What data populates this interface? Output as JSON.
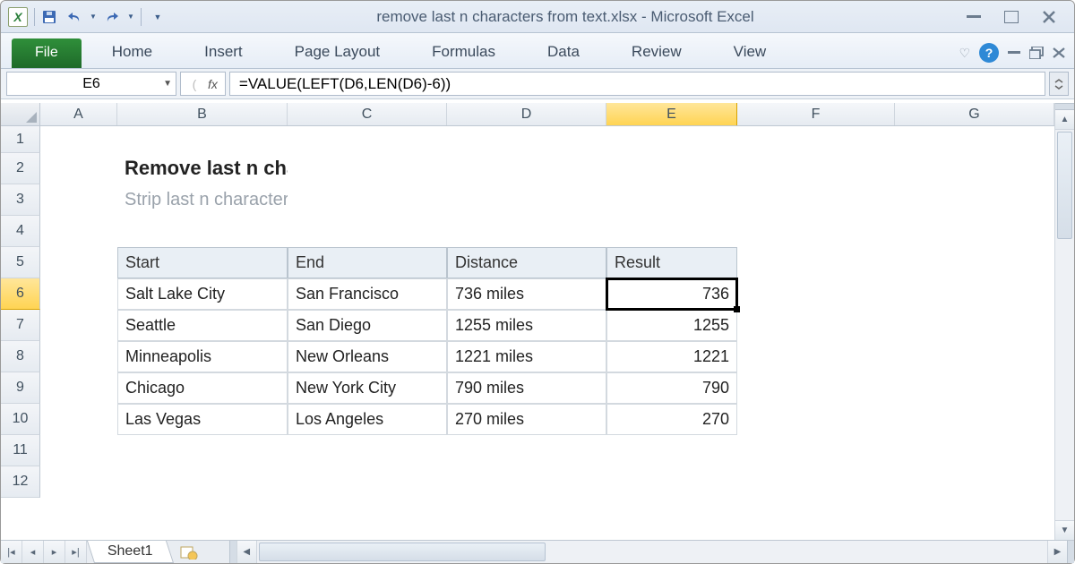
{
  "window": {
    "title": "remove last n characters from text.xlsx  -  Microsoft Excel"
  },
  "ribbon": {
    "file": "File",
    "tabs": [
      "Home",
      "Insert",
      "Page Layout",
      "Formulas",
      "Data",
      "Review",
      "View"
    ]
  },
  "formula_bar": {
    "namebox": "E6",
    "fx_label": "fx",
    "formula": "=VALUE(LEFT(D6,LEN(D6)-6))"
  },
  "grid": {
    "columns": [
      "A",
      "B",
      "C",
      "D",
      "E",
      "F",
      "G"
    ],
    "rows": [
      "1",
      "2",
      "3",
      "4",
      "5",
      "6",
      "7",
      "8",
      "9",
      "10",
      "11",
      "12"
    ],
    "active_col": "E",
    "active_row": "6",
    "title": "Remove last n characters from text",
    "subtitle": "Strip last n characters from a text string",
    "headers": {
      "B": "Start",
      "C": "End",
      "D": "Distance",
      "E": "Result"
    },
    "data": [
      {
        "B": "Salt Lake City",
        "C": "San Francisco",
        "D": "736 miles",
        "E": "736"
      },
      {
        "B": "Seattle",
        "C": "San Diego",
        "D": "1255 miles",
        "E": "1255"
      },
      {
        "B": "Minneapolis",
        "C": "New Orleans",
        "D": "1221 miles",
        "E": "1221"
      },
      {
        "B": "Chicago",
        "C": "New York City",
        "D": "790 miles",
        "E": "790"
      },
      {
        "B": "Las Vegas",
        "C": "Los Angeles",
        "D": "270 miles",
        "E": "270"
      }
    ]
  },
  "sheets": {
    "active": "Sheet1"
  }
}
